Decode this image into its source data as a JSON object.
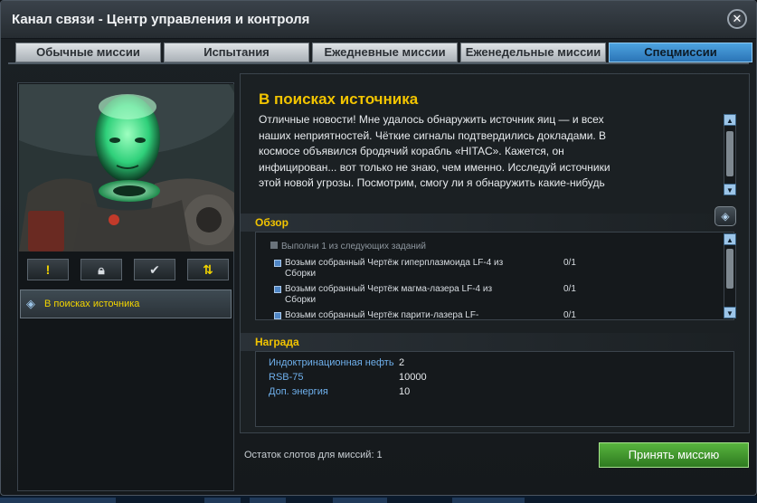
{
  "window": {
    "title": "Канал связи - Центр управления и контроля"
  },
  "tabs": [
    {
      "label": "Обычные миссии"
    },
    {
      "label": "Испытания"
    },
    {
      "label": "Ежедневные миссии"
    },
    {
      "label": "Еженедельные миссии"
    },
    {
      "label": "Спецмиссии"
    }
  ],
  "filters": {
    "active_icon": "exclamation-icon",
    "locked_icon": "lock-icon",
    "done_icon": "check-icon",
    "sort_icon": "arrows-up-down-icon"
  },
  "mission_list": [
    {
      "label": "В поисках источника"
    }
  ],
  "mission": {
    "title": "В поисках источника",
    "description": "Отличные новости! Мне удалось обнаружить источник яиц — и всех наших неприятностей. Чёткие сигналы подтвердились докладами. В космосе объявился бродячий корабль «HITAC». Кажется, он инфицирован... вот только не знаю, чем именно. Исследуй источники этой новой угрозы. Посмотрим, смогу ли я обнаружить какие-нибудь следы"
  },
  "overview": {
    "heading": "Обзор",
    "condition": "Выполни 1 из следующих заданий",
    "tasks": [
      {
        "text": "Возьми собранный Чертёж гиперплазмоида LF-4 из Сборки",
        "progress": "0/1"
      },
      {
        "text": "Возьми собранный Чертёж магма-лазера LF-4 из Сборки",
        "progress": "0/1"
      },
      {
        "text": "Возьми собранный Чертёж парити-лазера LF-",
        "progress": "0/1"
      }
    ]
  },
  "reward": {
    "heading": "Награда",
    "items": [
      {
        "name": "Индоктринационная нефть",
        "value": "2"
      },
      {
        "name": "RSB-75",
        "value": "10000"
      },
      {
        "name": "Доп. энергия",
        "value": "10"
      }
    ]
  },
  "footer": {
    "slots": "Остаток слотов для миссий: 1",
    "accept": "Принять миссию"
  }
}
